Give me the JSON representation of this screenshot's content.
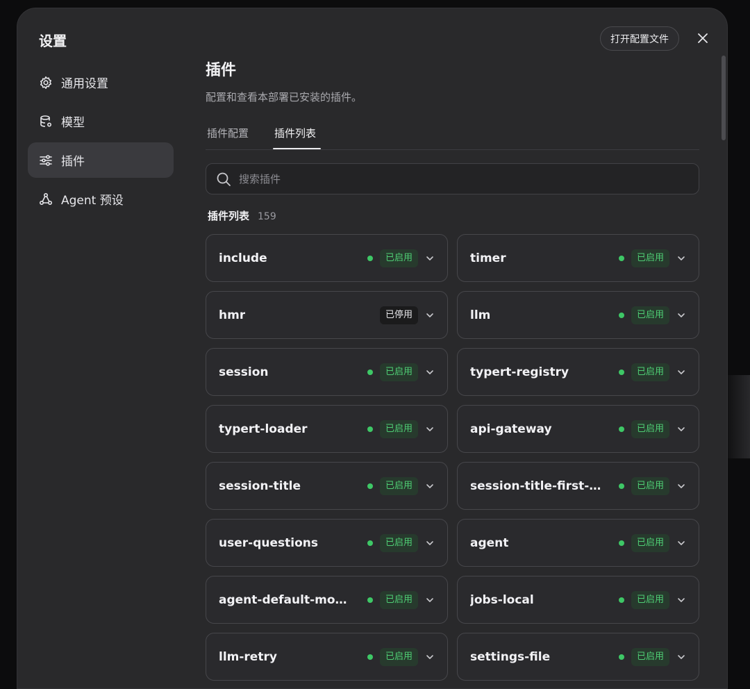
{
  "dialog": {
    "title": "设置"
  },
  "topbar": {
    "open_config_label": "打开配置文件"
  },
  "sidebar": {
    "items": [
      {
        "label": "通用设置",
        "icon": "gear-icon",
        "active": false
      },
      {
        "label": "模型",
        "icon": "database-gear-icon",
        "active": false
      },
      {
        "label": "插件",
        "icon": "sliders-icon",
        "active": true
      },
      {
        "label": "Agent 预设",
        "icon": "agent-nodes-icon",
        "active": false
      }
    ]
  },
  "main": {
    "title": "插件",
    "description": "配置和查看本部署已安装的插件。",
    "tabs": [
      {
        "label": "插件配置",
        "active": false
      },
      {
        "label": "插件列表",
        "active": true
      }
    ],
    "search": {
      "placeholder": "搜索插件",
      "value": ""
    },
    "list": {
      "title": "插件列表",
      "count": "159"
    }
  },
  "plugins": [
    {
      "name": "include",
      "status": "已启用",
      "enabled": true
    },
    {
      "name": "timer",
      "status": "已启用",
      "enabled": true
    },
    {
      "name": "hmr",
      "status": "已停用",
      "enabled": false
    },
    {
      "name": "llm",
      "status": "已启用",
      "enabled": true
    },
    {
      "name": "session",
      "status": "已启用",
      "enabled": true
    },
    {
      "name": "typert-registry",
      "status": "已启用",
      "enabled": true
    },
    {
      "name": "typert-loader",
      "status": "已启用",
      "enabled": true
    },
    {
      "name": "api-gateway",
      "status": "已启用",
      "enabled": true
    },
    {
      "name": "session-title",
      "status": "已启用",
      "enabled": true
    },
    {
      "name": "session-title-first-pr...",
      "status": "已启用",
      "enabled": true
    },
    {
      "name": "user-questions",
      "status": "已启用",
      "enabled": true
    },
    {
      "name": "agent",
      "status": "已启用",
      "enabled": true
    },
    {
      "name": "agent-default-model",
      "status": "已启用",
      "enabled": true
    },
    {
      "name": "jobs-local",
      "status": "已启用",
      "enabled": true
    },
    {
      "name": "llm-retry",
      "status": "已启用",
      "enabled": true
    },
    {
      "name": "settings-file",
      "status": "已启用",
      "enabled": true
    }
  ],
  "colors": {
    "enabled_dot": "#3ec766",
    "enabled_badge_text": "#4fcf75",
    "enabled_badge_bg": "#273a2d",
    "dialog_bg": "#29292b"
  }
}
